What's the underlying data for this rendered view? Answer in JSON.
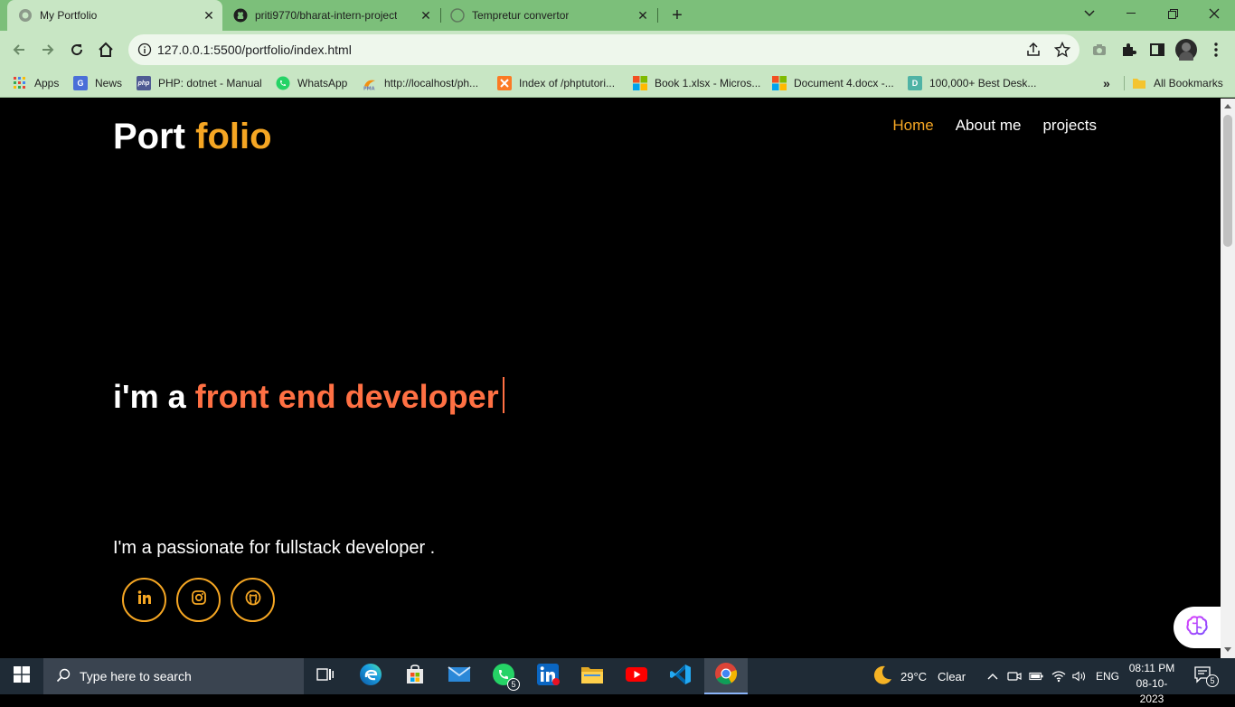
{
  "browser": {
    "tabs": [
      {
        "title": "My Portfolio",
        "icon": "globe-icon",
        "active": true
      },
      {
        "title": "priti9770/bharat-intern-project",
        "icon": "github-icon",
        "active": false
      },
      {
        "title": "Tempretur convertor",
        "icon": "globe-icon",
        "active": false
      }
    ],
    "url": "127.0.0.1:5500/portfolio/index.html",
    "bookmarks": [
      {
        "label": "Apps",
        "icon": "apps-grid-icon"
      },
      {
        "label": "News",
        "icon": "news-icon"
      },
      {
        "label": "PHP: dotnet - Manual",
        "icon": "php-icon"
      },
      {
        "label": "WhatsApp",
        "icon": "whatsapp-icon"
      },
      {
        "label": "http://localhost/ph...",
        "icon": "phpmyadmin-icon"
      },
      {
        "label": "Index of /phptutori...",
        "icon": "xampp-icon"
      },
      {
        "label": "Book 1.xlsx - Micros...",
        "icon": "microsoft-icon"
      },
      {
        "label": "Document 4.docx -...",
        "icon": "microsoft-icon"
      },
      {
        "label": "100,000+ Best Desk...",
        "icon": "desktop-site-icon"
      }
    ],
    "all_bookmarks_label": "All Bookmarks"
  },
  "page": {
    "logo": {
      "part1": "Port",
      "part2": "folio"
    },
    "nav": [
      {
        "label": "Home",
        "active": true
      },
      {
        "label": "About me",
        "active": false
      },
      {
        "label": "projects",
        "active": false
      }
    ],
    "hero": {
      "prefix": "i'm a",
      "typed": "front end developer"
    },
    "tagline": "I'm a passionate for fullstack developer .",
    "socials": [
      "linkedin-icon",
      "instagram-icon",
      "github-icon"
    ],
    "accent_color": "#f5a623",
    "typed_color": "#ff7043"
  },
  "taskbar": {
    "search_placeholder": "Type here to search",
    "whatsapp_badge": "5",
    "notification_badge": "5",
    "weather": {
      "temp": "29°C",
      "condition": "Clear"
    },
    "language": "ENG",
    "time": "08:11 PM",
    "date": "08-10-2023"
  }
}
